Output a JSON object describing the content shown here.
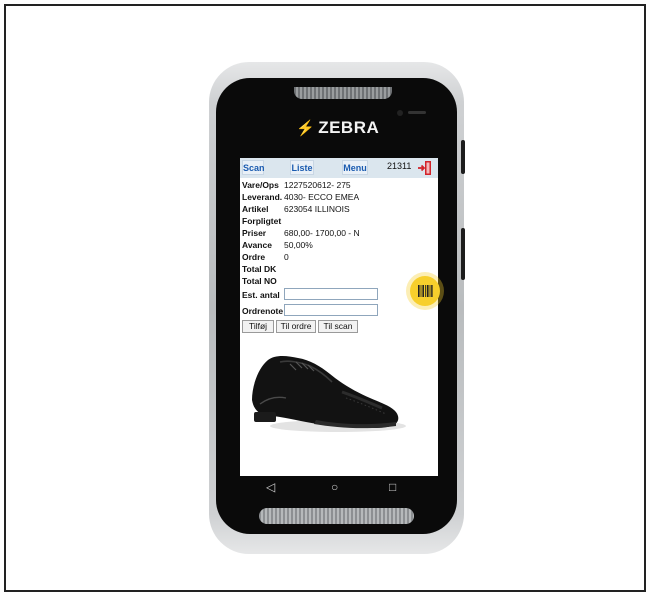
{
  "device": {
    "brand": "ZEBRA"
  },
  "app": {
    "toolbar": {
      "scan_label": "Scan",
      "list_label": "Liste",
      "menu_label": "Menu",
      "counter": "21311",
      "exit_icon": "exit-door-icon"
    },
    "details": [
      {
        "label": "Vare/Ops",
        "value": "1227520612- 275"
      },
      {
        "label": "Leverand.",
        "value": "4030- ECCO EMEA"
      },
      {
        "label": "Artikel",
        "value": "623054 ILLINOIS"
      },
      {
        "label": "Forpligtet",
        "value": ""
      },
      {
        "label": "Priser",
        "value": "680,00- 1700,00 - N"
      },
      {
        "label": "Avance",
        "value": "50,00%"
      },
      {
        "label": "Ordre",
        "value": "0"
      },
      {
        "label": "Total DK",
        "value": ""
      },
      {
        "label": "Total NO",
        "value": ""
      }
    ],
    "form": {
      "est_antal_label": "Est. antal",
      "est_antal_value": "",
      "ordrenote_label": "Ordrenote",
      "ordrenote_value": ""
    },
    "actions": {
      "add_label": "Tilføj",
      "to_order_label": "Til ordre",
      "to_scan_label": "Til scan"
    },
    "product_image": "black-leather-brogue-shoe",
    "scan_fab_icon": "barcode-icon"
  },
  "system_nav": {
    "back_icon": "◁",
    "home_icon": "○",
    "recents_icon": "□"
  },
  "colors": {
    "accent_blue": "#1a5bb0",
    "toolbar_bg": "#dbe6ee",
    "scan_fab": "#f7cf2c",
    "exit_red": "#d2232a"
  }
}
